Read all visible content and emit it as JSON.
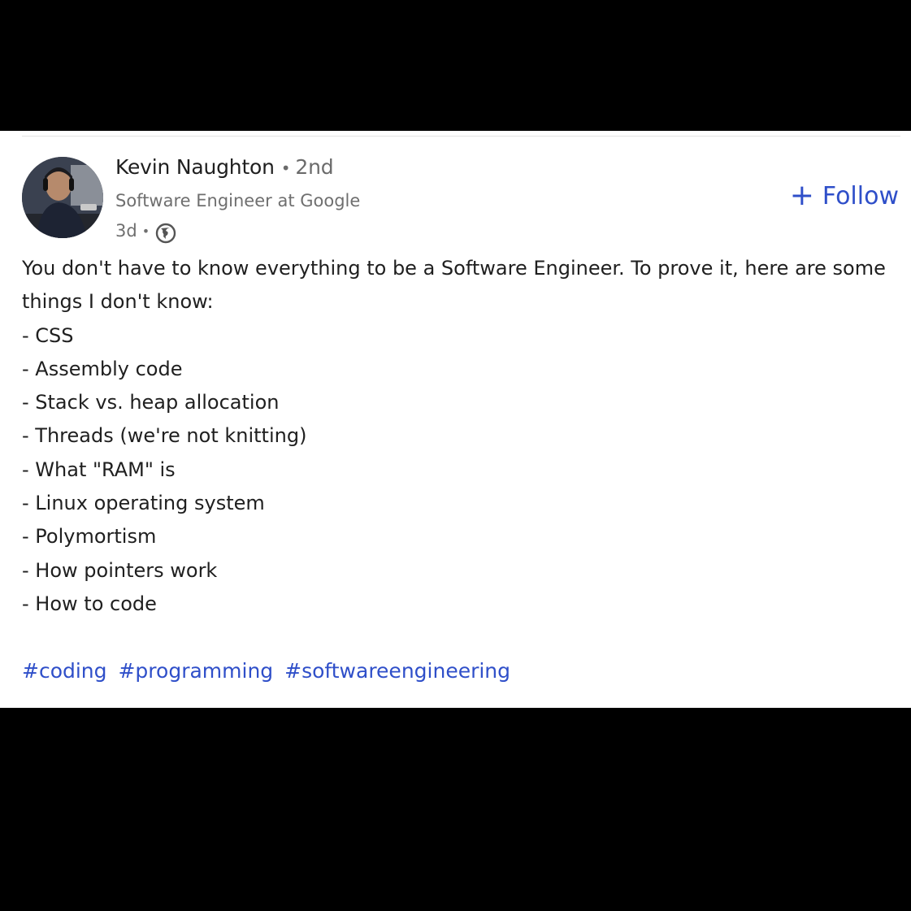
{
  "post": {
    "author": {
      "name": "Kevin Naughton",
      "degree_separator": "•",
      "degree": "2nd",
      "headline": "Software Engineer at Google",
      "time_ago": "3d",
      "meta_separator": "•",
      "visibility_icon": "globe-icon"
    },
    "follow_label": "Follow",
    "follow_icon": "+",
    "intro": "You don't have to know everything to be a Software Engineer. To prove it, here are some things I don't know:",
    "list_items": [
      "- CSS",
      "- Assembly code",
      "- Stack vs. heap allocation",
      "- Threads (we're not knitting)",
      "- What \"RAM\" is",
      "- Linux operating system",
      "- Polymortism",
      "- How pointers work",
      "- How to code"
    ],
    "hashtags": [
      "#coding",
      "#programming",
      "#softwareengineering"
    ]
  },
  "colors": {
    "link": "#2f4fc9",
    "text": "#1f1f1f",
    "muted": "#6f6f6f",
    "background": "#000000",
    "card": "#ffffff"
  }
}
